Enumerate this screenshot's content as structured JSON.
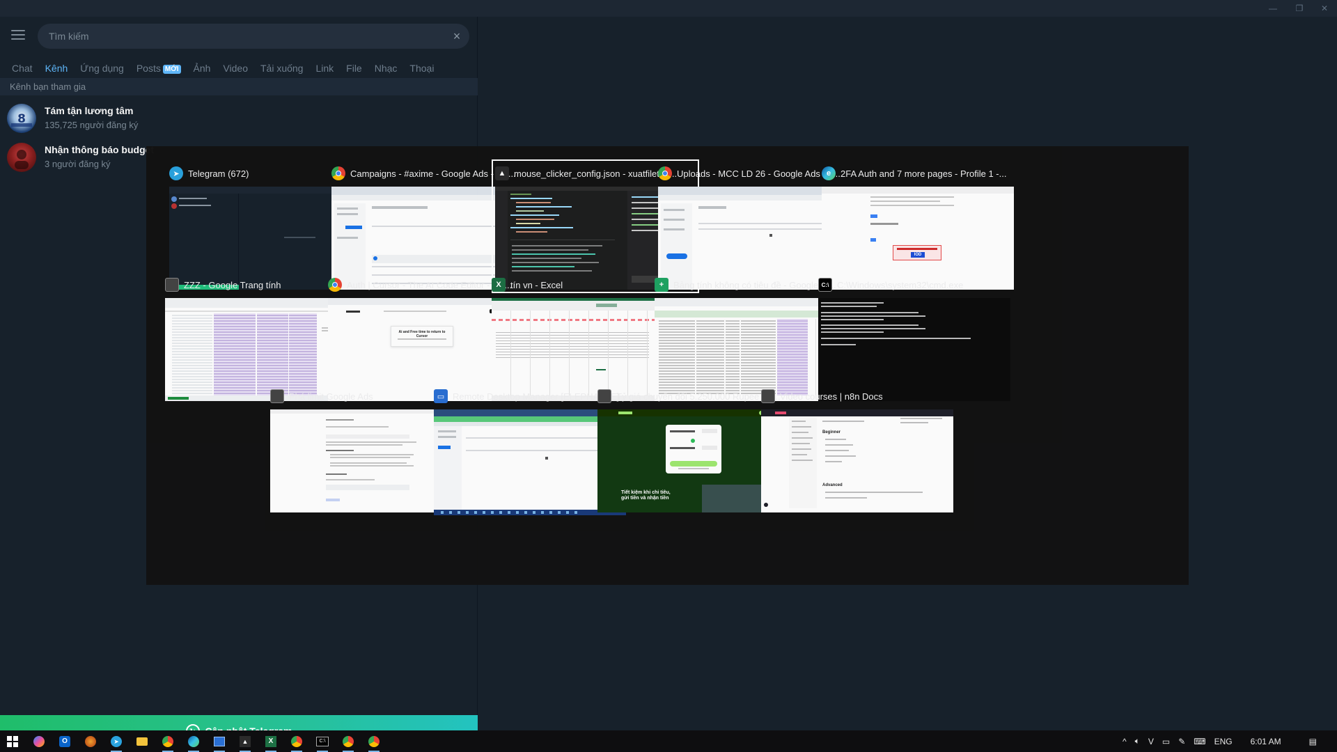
{
  "window": {
    "controls": [
      "—",
      "❐",
      "✕"
    ]
  },
  "search": {
    "placeholder": "Tìm kiếm",
    "clear_icon": "×"
  },
  "tabs": [
    {
      "label": "Chat"
    },
    {
      "label": "Kênh",
      "active": true
    },
    {
      "label": "Ứng dụng"
    },
    {
      "label": "Posts",
      "badge": "MỚI"
    },
    {
      "label": "Ảnh"
    },
    {
      "label": "Video"
    },
    {
      "label": "Tải xuống"
    },
    {
      "label": "Link"
    },
    {
      "label": "File"
    },
    {
      "label": "Nhạc"
    },
    {
      "label": "Thoại"
    }
  ],
  "section_label": "Kênh bạn tham gia",
  "channels": [
    {
      "name": "Tám tận lương tâm",
      "subscribers": "135,725 người đăng ký"
    },
    {
      "name": "Nhận thông báo budget",
      "subscribers": "3 người đăng ký"
    }
  ],
  "update_button": {
    "label": "Cập nhật Telegram"
  },
  "task_switcher": {
    "windows": [
      {
        "title": "Telegram (672)",
        "icon": "telegram-icon",
        "color": "#2aa3df"
      },
      {
        "title": "Campaigns - #axime - Google Ads - Go...",
        "icon": "chrome-icon",
        "color": "#e44134"
      },
      {
        "title": "mouse_clicker_config.json - xuatfiletud...",
        "icon": "cursor-icon",
        "color": "#2b2b2b",
        "selected": true
      },
      {
        "title": "Uploads - MCC LD 26 - Google Ads - G...",
        "icon": "chrome-icon",
        "color": "#e44134"
      },
      {
        "title": "2FA Auth and 7 more pages - Profile 1 -...",
        "icon": "edge-icon",
        "color": "#1a8ad4"
      },
      {
        "title": "ZZZ - Google Trang tính",
        "icon": "window-icon",
        "color": "#444444"
      },
      {
        "title": "Auth | Cursor - The AI Code Editor - Go...",
        "icon": "chrome-icon",
        "color": "#e44134"
      },
      {
        "title": "tín vn - Excel",
        "icon": "excel-icon",
        "color": "#1d7044"
      },
      {
        "title": "Bảng tính không có tiêu đề - Google Tr...",
        "icon": "sheets-icon",
        "color": "#1fa463"
      },
      {
        "title": "C:\\Windows\\system32\\cmd.exe",
        "icon": "cmd-icon",
        "color": "#000000"
      },
      {
        "title": "Phá limit Google Ads",
        "icon": "window-icon",
        "color": "#444444"
      },
      {
        "title": "Remote Desktop Manager [ELEPHANLE]",
        "icon": "rdm-icon",
        "color": "#2a6fd4"
      },
      {
        "title": "Tỷ giá chuyển đổi 5.250.000 Rupee Ấn...",
        "icon": "window-icon",
        "color": "#444444"
      },
      {
        "title": "Video courses | n8n Docs",
        "icon": "window-icon",
        "color": "#444444"
      }
    ],
    "preview_text": {
      "telegram_center": "",
      "cursor_dialog": "Ai and Free time to return to Cursor",
      "wise_headline": "Tiết kiệm khi chi tiêu, gửi tiền và nhận tiền",
      "n8n_heading": "Beginner",
      "n8n_heading2": "Advanced",
      "badge_text": "IOD"
    }
  },
  "taskbar": {
    "apps": [
      {
        "name": "start-button",
        "glyph": "⊞"
      },
      {
        "name": "copilot-app",
        "glyph": "◐"
      },
      {
        "name": "outlook-app",
        "glyph": "O"
      },
      {
        "name": "game-app",
        "glyph": "●"
      },
      {
        "name": "telegram-app",
        "glyph": "➤"
      },
      {
        "name": "file-explorer-app",
        "glyph": "▬"
      },
      {
        "name": "chrome-app",
        "glyph": "◉"
      },
      {
        "name": "edge-app",
        "glyph": "e"
      },
      {
        "name": "remote-desktop-app",
        "glyph": "▭"
      },
      {
        "name": "cursor-app",
        "glyph": "▲"
      },
      {
        "name": "excel-app",
        "glyph": "X"
      },
      {
        "name": "chrome-app-2",
        "glyph": "◉"
      },
      {
        "name": "cmd-app",
        "glyph": "C:\\"
      },
      {
        "name": "chrome-app-3",
        "glyph": "◉"
      },
      {
        "name": "chrome-app-4",
        "glyph": "◉"
      }
    ],
    "tray": {
      "chevron": "^",
      "language": "ENG",
      "time": "6:01 AM",
      "notification": "▤"
    }
  },
  "colors": {
    "accent": "#5eb5f7",
    "panel_bg": "#17212b",
    "update_green": "#1fbd6a"
  }
}
